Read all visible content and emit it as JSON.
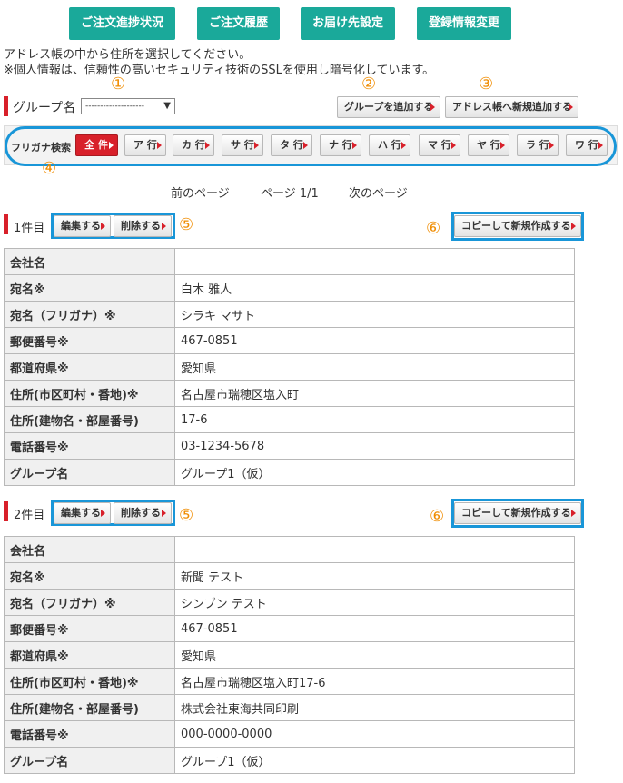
{
  "nav": {
    "buttons": [
      "ご注文進捗状況",
      "ご注文履歴",
      "お届け先設定",
      "登録情報変更"
    ]
  },
  "intro": {
    "line1": "アドレス帳の中から住所を選択してください。",
    "line2": "※個人情報は、信頼性の高いセキュリティ技術のSSLを使用し暗号化しています。"
  },
  "markers": {
    "m1": "①",
    "m2": "②",
    "m3": "③",
    "m4": "④",
    "m5": "⑤",
    "m6": "⑥"
  },
  "group": {
    "label": "グループ名",
    "selected": "--------------------",
    "add_group": "グループを追加する",
    "add_address": "アドレス帳へ新規追加する"
  },
  "kana": {
    "label": "フリガナ検索",
    "buttons": [
      "全 件",
      "ア 行",
      "カ 行",
      "サ 行",
      "タ 行",
      "ナ 行",
      "ハ 行",
      "マ 行",
      "ヤ 行",
      "ラ 行",
      "ワ 行"
    ]
  },
  "pager": {
    "prev": "前のページ",
    "page": "ページ 1/1",
    "next": "次のページ"
  },
  "actions": {
    "edit": "編集する",
    "delete": "削除する",
    "copy": "コピーして新規作成する"
  },
  "records": [
    {
      "label": "1件目",
      "rows": [
        {
          "k": "会社名",
          "v": ""
        },
        {
          "k": "宛名※",
          "v": "白木 雅人"
        },
        {
          "k": "宛名（フリガナ）※",
          "v": "シラキ マサト"
        },
        {
          "k": "郵便番号※",
          "v": "467-0851"
        },
        {
          "k": "都道府県※",
          "v": "愛知県"
        },
        {
          "k": "住所(市区町村・番地)※",
          "v": "名古屋市瑞穂区塩入町"
        },
        {
          "k": "住所(建物名・部屋番号)",
          "v": "17-6"
        },
        {
          "k": "電話番号※",
          "v": "03-1234-5678"
        },
        {
          "k": "グループ名",
          "v": "グループ1（仮）"
        }
      ]
    },
    {
      "label": "2件目",
      "rows": [
        {
          "k": "会社名",
          "v": ""
        },
        {
          "k": "宛名※",
          "v": "新聞 テスト"
        },
        {
          "k": "宛名（フリガナ）※",
          "v": "シンブン テスト"
        },
        {
          "k": "郵便番号※",
          "v": "467-0851"
        },
        {
          "k": "都道府県※",
          "v": "愛知県"
        },
        {
          "k": "住所(市区町村・番地)※",
          "v": "名古屋市瑞穂区塩入町17-6"
        },
        {
          "k": "住所(建物名・部屋番号)",
          "v": "株式会社東海共同印刷"
        },
        {
          "k": "電話番号※",
          "v": "000-0000-0000"
        },
        {
          "k": "グループ名",
          "v": "グループ1（仮）"
        }
      ]
    }
  ]
}
